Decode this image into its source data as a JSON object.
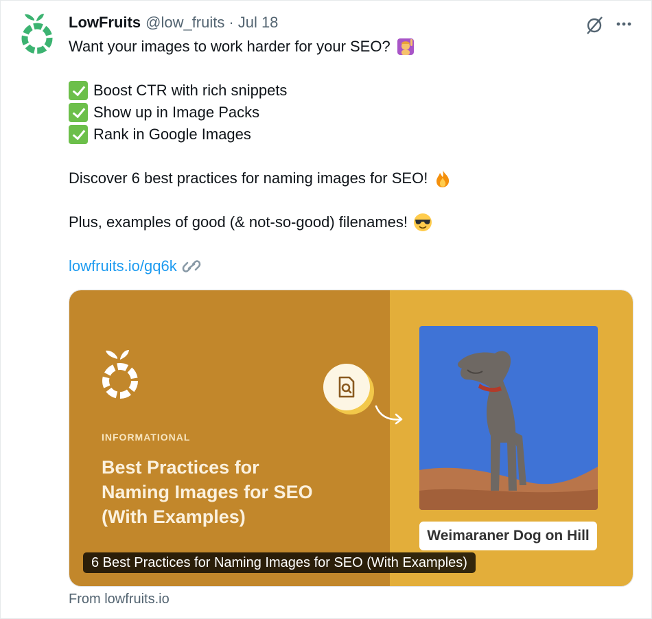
{
  "tweet": {
    "author_name": "LowFruits",
    "handle": "@low_fruits",
    "separator": "·",
    "date": "Jul 18",
    "lines": {
      "l1": "Want your images to work harder for your SEO?",
      "c1": "Boost CTR with rich snippets",
      "c2": "Show up in Image Packs",
      "c3": "Rank in Google Images",
      "d1": "Discover 6 best practices for naming images for SEO!",
      "p1": "Plus, examples of good (& not-so-good) filenames!"
    },
    "link_text": "lowfruits.io/gq6k"
  },
  "card": {
    "category": "INFORMATIONAL",
    "title_line1": "Best Practices for",
    "title_line2": "Naming Images for SEO",
    "title_line3": "(With Examples)",
    "image_caption": "Weimaraner Dog on Hill",
    "overlay_title": "6 Best Practices for Naming Images for SEO (With Examples)",
    "from": "From lowfruits.io"
  },
  "colors": {
    "brand_green": "#3cb371",
    "link_blue": "#1d9bf0",
    "card_left": "#c2872b",
    "card_right": "#e3ae3a"
  },
  "icons": [
    "lowfruits-logo-icon",
    "grok-icon",
    "more-icon",
    "raising-hand-emoji",
    "check-emoji",
    "fire-emoji",
    "sunglasses-emoji",
    "link-icon",
    "search-document-icon",
    "curved-arrow-icon"
  ]
}
